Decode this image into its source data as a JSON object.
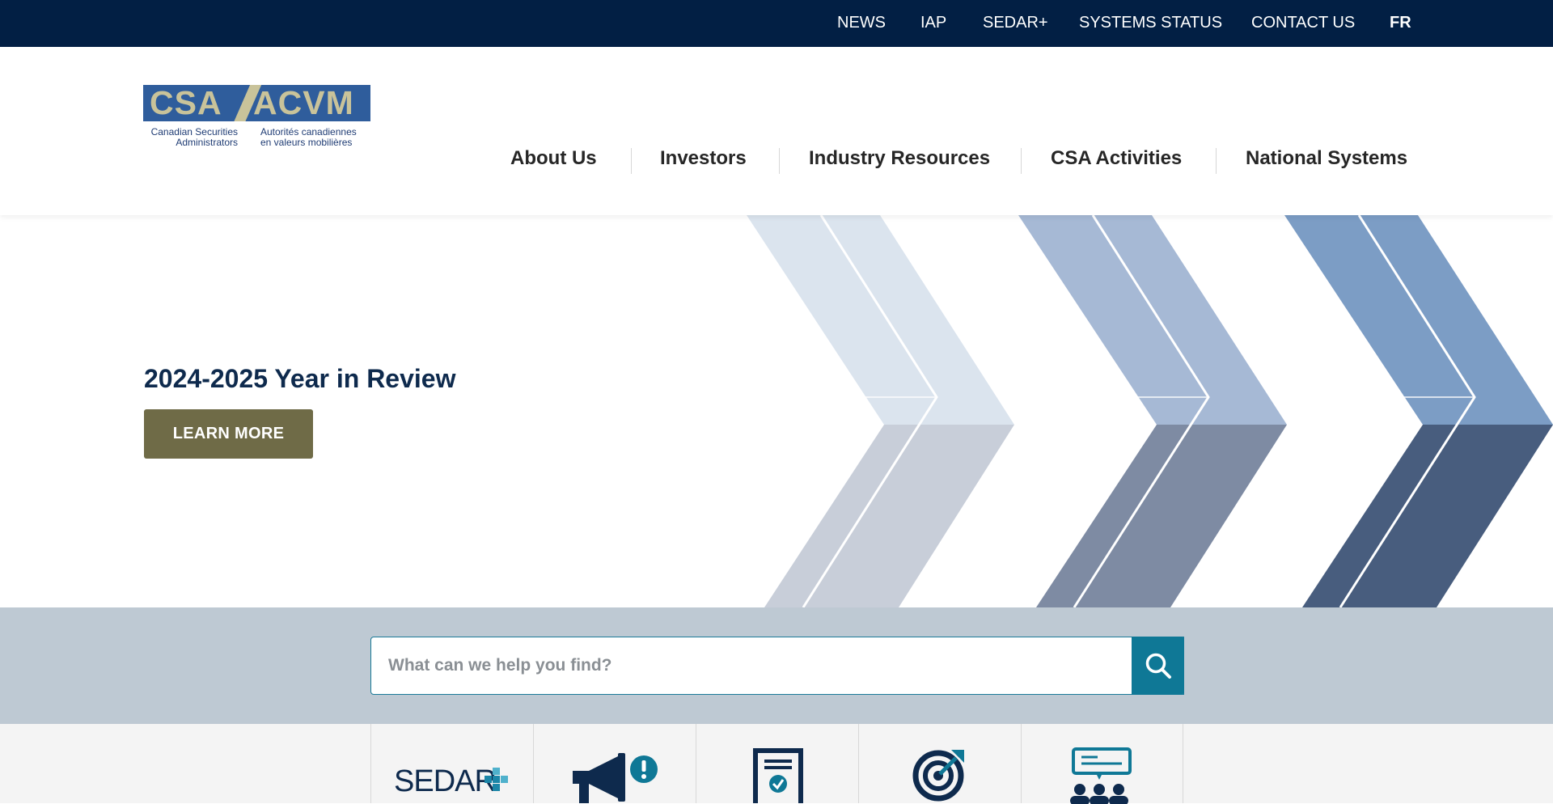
{
  "utility_nav": {
    "news": "NEWS",
    "iap": "IAP",
    "sedar": "SEDAR+",
    "systems_status": "SYSTEMS STATUS",
    "contact": "CONTACT US",
    "lang": "FR"
  },
  "logo": {
    "left_mark": "CSA",
    "right_mark": "ACVM",
    "en_line1": "Canadian Securities",
    "en_line2": "Administrators",
    "fr_line1": "Autorités canadiennes",
    "fr_line2": "en valeurs mobilières"
  },
  "main_nav": {
    "about": "About Us",
    "investors": "Investors",
    "industry": "Industry Resources",
    "activities": "CSA Activities",
    "systems": "National Systems"
  },
  "hero": {
    "title": "2024-2025 Year in Review",
    "button": "LEARN MORE"
  },
  "search": {
    "placeholder": "What can we help you find?",
    "value": ""
  },
  "quick_links": {
    "sedar_label": "SEDAR",
    "icons": [
      "sedar-plus-logo",
      "megaphone-alert-icon",
      "certificate-check-icon",
      "target-arrow-icon",
      "group-discussion-icon"
    ]
  },
  "colors": {
    "top_bar": "#021f44",
    "button": "#6f6b47",
    "search_accent": "#0f7896",
    "search_band": "#bec9d3",
    "title": "#0e2a4d"
  }
}
